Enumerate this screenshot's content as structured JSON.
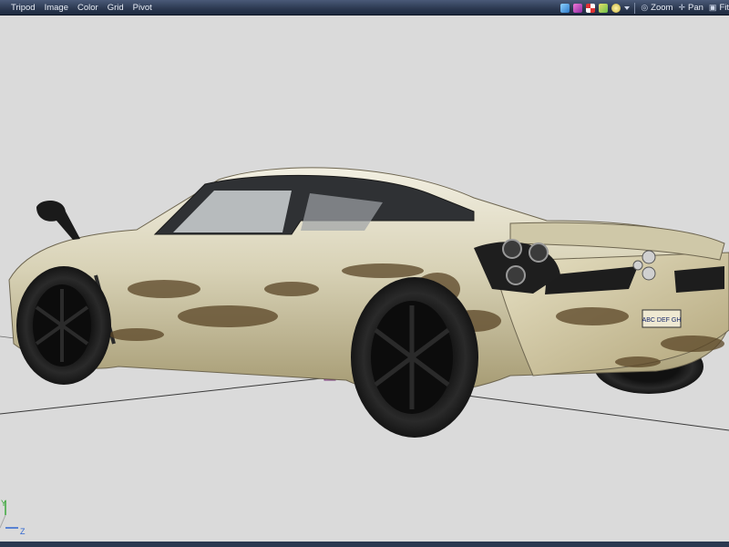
{
  "menubar": {
    "items": [
      "Tripod",
      "Image",
      "Color",
      "Grid",
      "Pivot"
    ],
    "nav": [
      {
        "label": "Zoom",
        "icon": "zoom-icon"
      },
      {
        "label": "Pan",
        "icon": "pan-icon"
      },
      {
        "label": "Fit",
        "icon": "fit-icon"
      }
    ]
  },
  "viewport": {
    "license_plate": "ABC DEF GH",
    "axis_labels": {
      "y": "Y",
      "z": "Z"
    }
  },
  "colors": {
    "menubar": "#2b3850",
    "viewport_bg": "#dadada",
    "car_body": "#d8d2b8",
    "mud": "#5a4526",
    "tire": "#1b1b1b",
    "axis_y": "#3aa83a",
    "axis_z": "#2f66d0"
  }
}
